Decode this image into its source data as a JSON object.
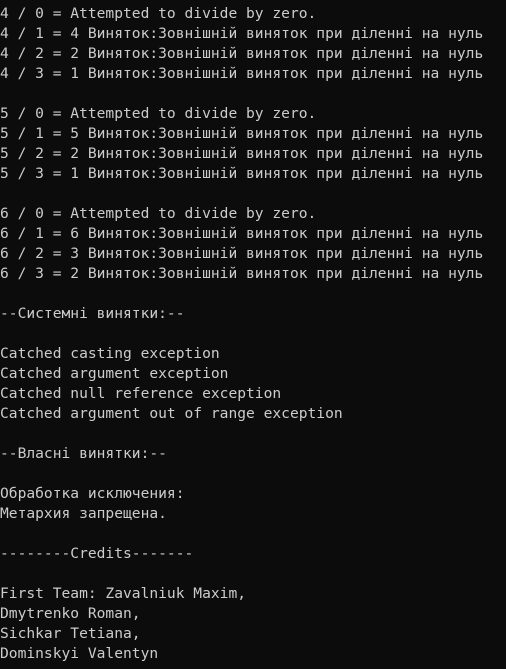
{
  "console": {
    "lines": [
      "4 / 0 = Attempted to divide by zero.",
      "4 / 1 = 4 Виняток:Зовнішній виняток при діленні на нуль",
      "4 / 2 = 2 Виняток:Зовнішній виняток при діленні на нуль",
      "4 / 3 = 1 Виняток:Зовнішній виняток при діленні на нуль",
      "",
      "5 / 0 = Attempted to divide by zero.",
      "5 / 1 = 5 Виняток:Зовнішній виняток при діленні на нуль",
      "5 / 2 = 2 Виняток:Зовнішній виняток при діленні на нуль",
      "5 / 3 = 1 Виняток:Зовнішній виняток при діленні на нуль",
      "",
      "6 / 0 = Attempted to divide by zero.",
      "6 / 1 = 6 Виняток:Зовнішній виняток при діленні на нуль",
      "6 / 2 = 3 Виняток:Зовнішній виняток при діленні на нуль",
      "6 / 3 = 2 Виняток:Зовнішній виняток при діленні на нуль",
      "",
      "--Системні винятки:--",
      "",
      "Catched casting exception",
      "Catched argument exception",
      "Catched null reference exception",
      "Catched argument out of range exception",
      "",
      "--Власні винятки:--",
      "",
      "Обработка исключения:",
      "Метархия запрещена.",
      "",
      "--------Credits-------",
      "",
      "First Team: Zavalniuk Maxim,",
      "Dmytrenko Roman,",
      "Sichkar Tetiana,",
      "Dominskyi Valentyn"
    ]
  },
  "colors": {
    "background": "#0c0c0c",
    "text": "#cccccc"
  }
}
